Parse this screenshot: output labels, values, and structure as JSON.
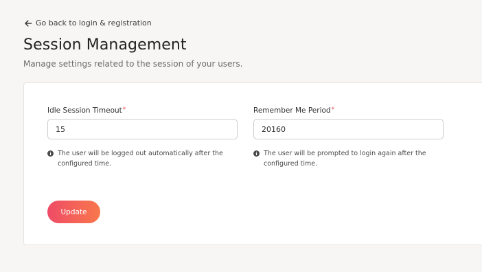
{
  "back_link": {
    "label": "Go back to login & registration",
    "icon": "arrow-left-icon"
  },
  "header": {
    "title": "Session Management",
    "subtitle": "Manage settings related to the session of your users."
  },
  "form": {
    "idle_timeout": {
      "label": "Idle Session Timeout",
      "required_mark": "*",
      "value": "15",
      "hint": "The user will be logged out automatically after the configured time.",
      "hint_icon": "info-icon"
    },
    "remember_me": {
      "label": "Remember Me Period",
      "required_mark": "*",
      "value": "20160",
      "hint": "The user will be prompted to login again after the configured time.",
      "hint_icon": "info-icon"
    },
    "submit_label": "Update"
  },
  "colors": {
    "accent_start": "#ef4b66",
    "accent_end": "#f8784c",
    "required": "#e5484d",
    "background": "#f7f6f5"
  }
}
